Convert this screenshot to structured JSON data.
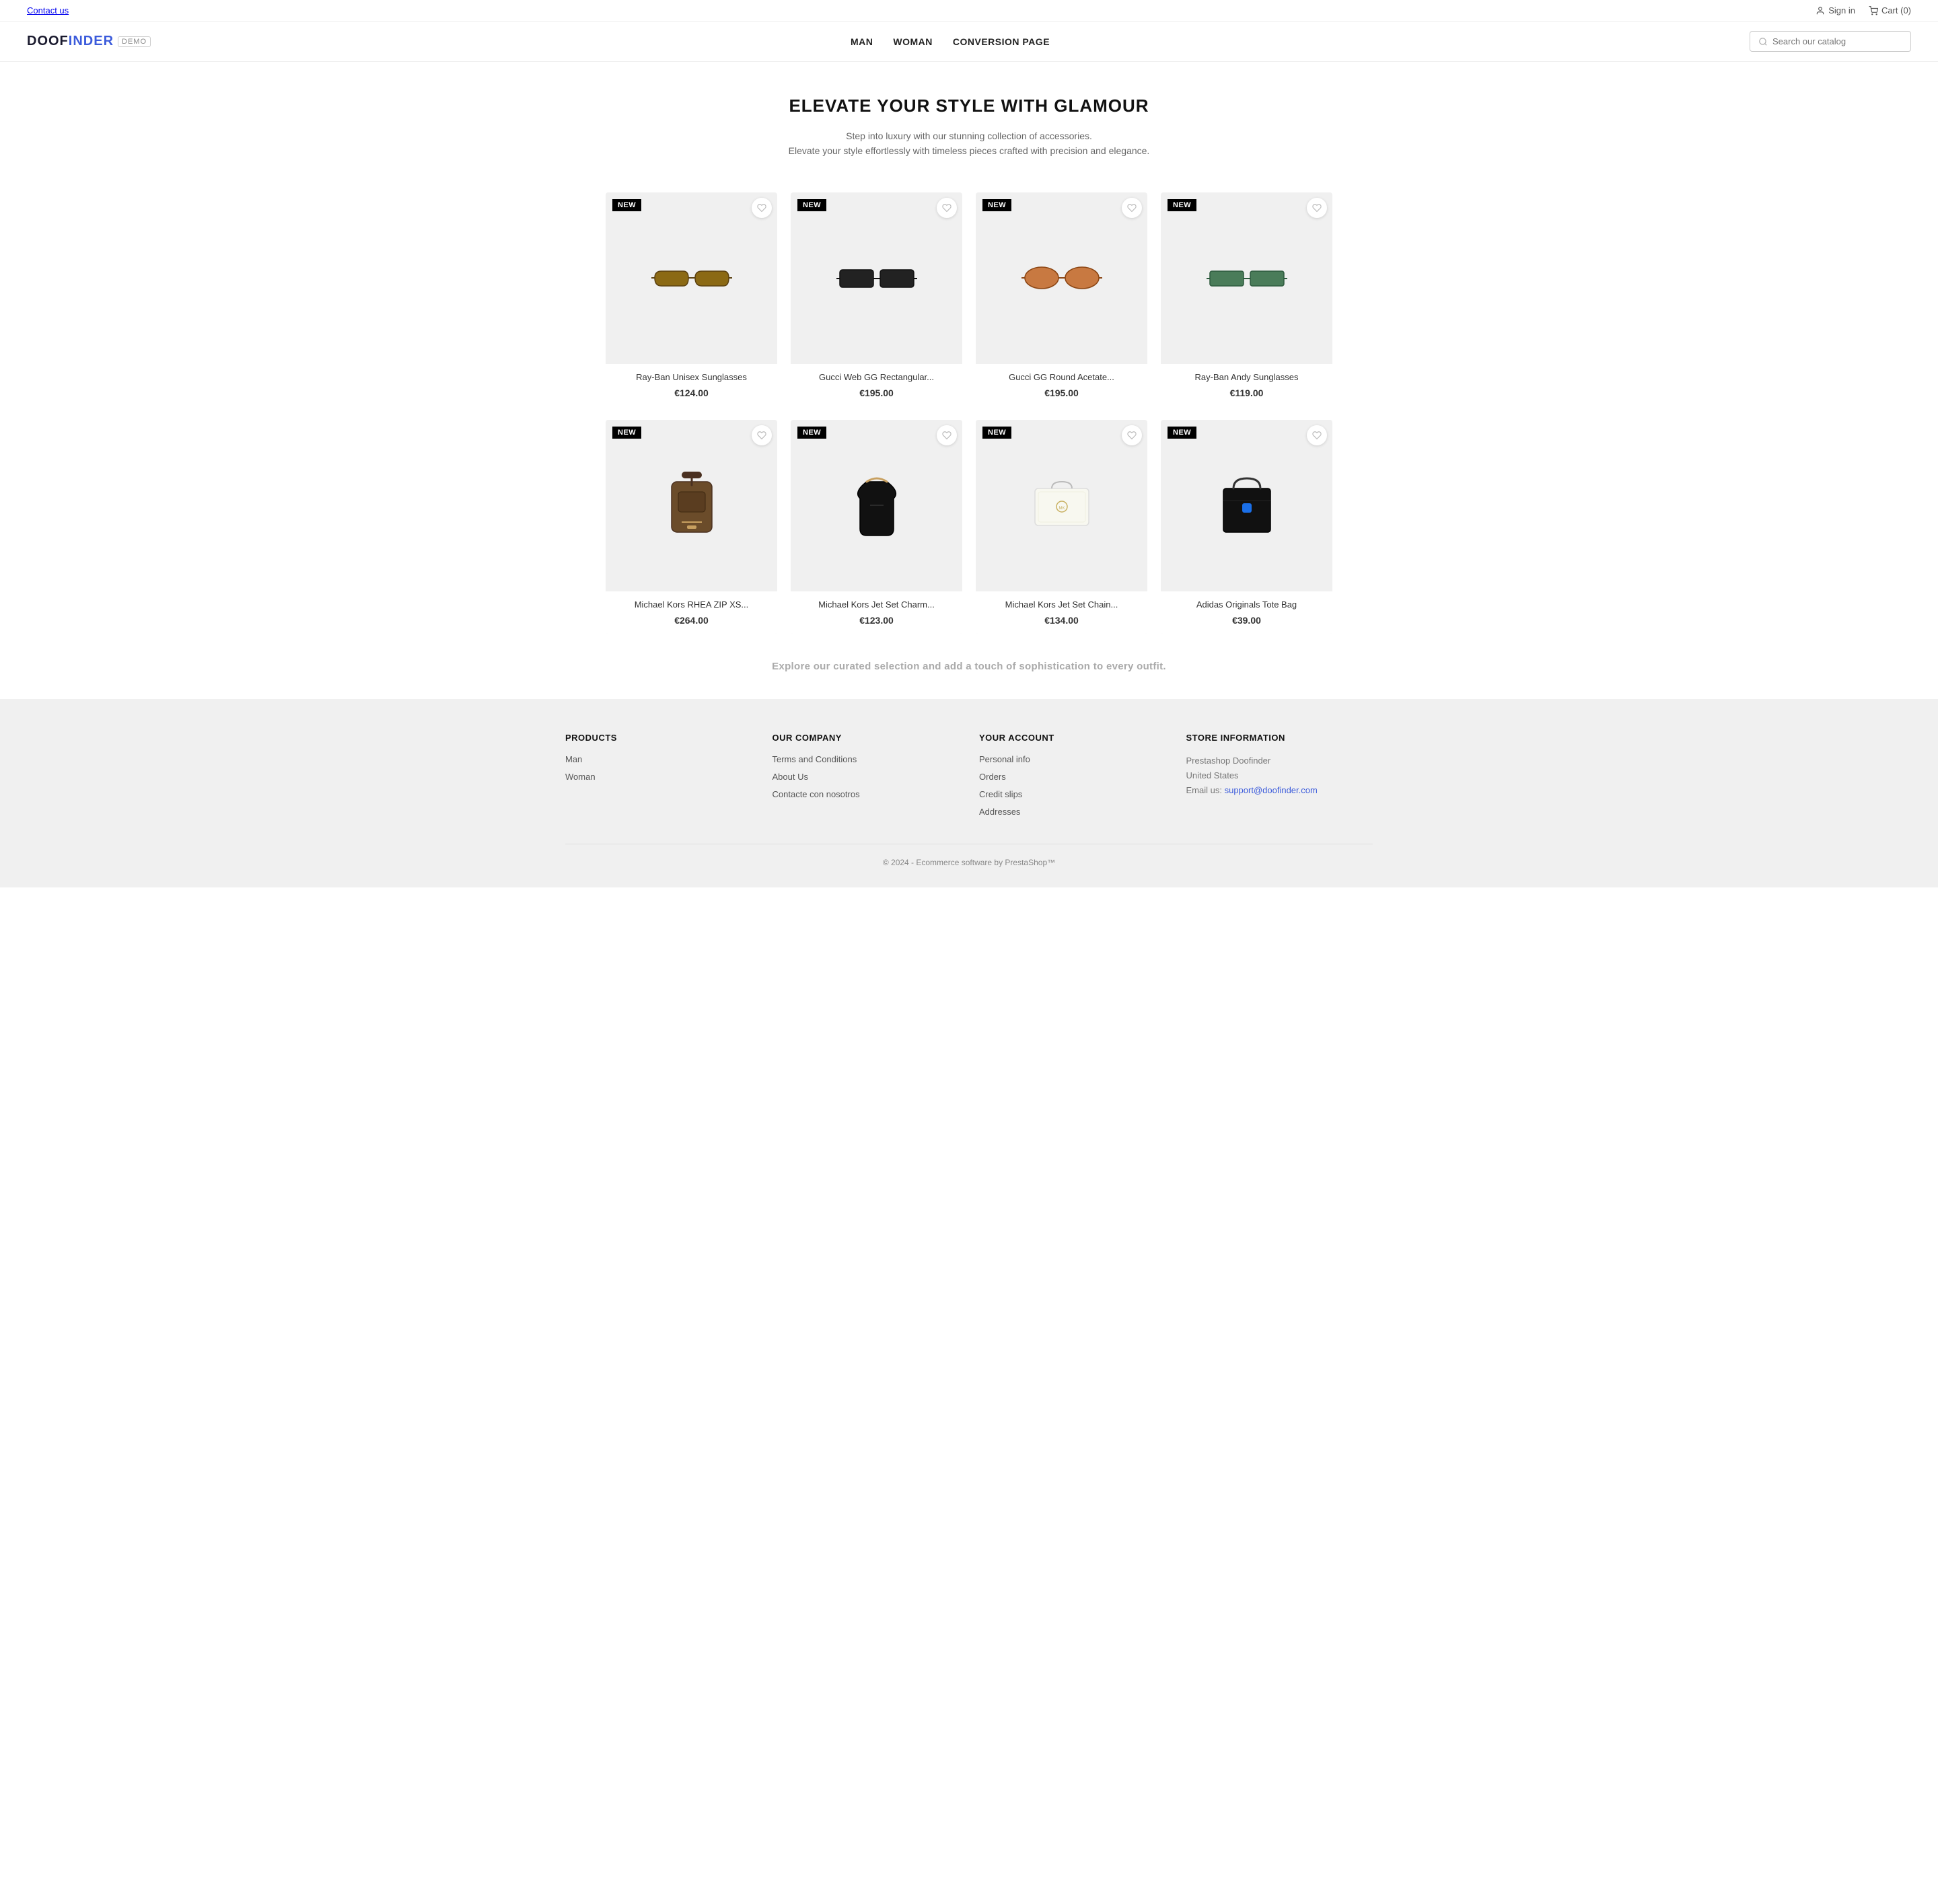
{
  "topbar": {
    "contact_label": "Contact us",
    "signin_label": "Sign in",
    "cart_label": "Cart (0)"
  },
  "header": {
    "logo_text": "DOOFINDER",
    "logo_sep": "|",
    "logo_demo": "DEMO",
    "nav": [
      {
        "label": "MAN",
        "href": "#"
      },
      {
        "label": "WOMAN",
        "href": "#"
      },
      {
        "label": "CONVERSION PAGE",
        "href": "#"
      }
    ],
    "search_placeholder": "Search our catalog"
  },
  "hero": {
    "title": "ELEVATE YOUR STYLE WITH GLAMOUR",
    "subtitle1": "Step into luxury with our stunning collection of accessories.",
    "subtitle2": "Elevate your style effortlessly with timeless pieces crafted with precision and elegance."
  },
  "products": [
    {
      "id": 1,
      "badge": "NEW",
      "name": "Ray-Ban Unisex Sunglasses",
      "price": "€124.00",
      "type": "sunglasses-brown"
    },
    {
      "id": 2,
      "badge": "NEW",
      "name": "Gucci Web GG Rectangular...",
      "price": "€195.00",
      "type": "sunglasses-black"
    },
    {
      "id": 3,
      "badge": "NEW",
      "name": "Gucci GG Round Acetate...",
      "price": "€195.00",
      "type": "sunglasses-tort"
    },
    {
      "id": 4,
      "badge": "NEW",
      "name": "Ray-Ban Andy Sunglasses",
      "price": "€119.00",
      "type": "sunglasses-green"
    },
    {
      "id": 5,
      "badge": "NEW",
      "name": "Michael Kors RHEA ZIP XS...",
      "price": "€264.00",
      "type": "bag-backpack"
    },
    {
      "id": 6,
      "badge": "NEW",
      "name": "Michael Kors Jet Set Charm...",
      "price": "€123.00",
      "type": "bag-shoulder"
    },
    {
      "id": 7,
      "badge": "NEW",
      "name": "Michael Kors Jet Set Chain...",
      "price": "€134.00",
      "type": "bag-white"
    },
    {
      "id": 8,
      "badge": "NEW",
      "name": "Adidas Originals Tote Bag",
      "price": "€39.00",
      "type": "bag-tote"
    }
  ],
  "curated_text": "Explore our curated selection and add a touch of sophistication to every outfit.",
  "footer": {
    "products_title": "PRODUCTS",
    "products_links": [
      {
        "label": "Man"
      },
      {
        "label": "Woman"
      }
    ],
    "company_title": "OUR COMPANY",
    "company_links": [
      {
        "label": "Terms and Conditions"
      },
      {
        "label": "About Us"
      },
      {
        "label": "Contacte con nosotros"
      }
    ],
    "account_title": "YOUR ACCOUNT",
    "account_links": [
      {
        "label": "Personal info"
      },
      {
        "label": "Orders"
      },
      {
        "label": "Credit slips"
      },
      {
        "label": "Addresses"
      }
    ],
    "store_title": "STORE INFORMATION",
    "store_name": "Prestashop Doofinder",
    "store_country": "United States",
    "store_email_label": "Email us:",
    "store_email": "support@doofinder.com",
    "copyright": "© 2024 - Ecommerce software by PrestaShop™"
  }
}
